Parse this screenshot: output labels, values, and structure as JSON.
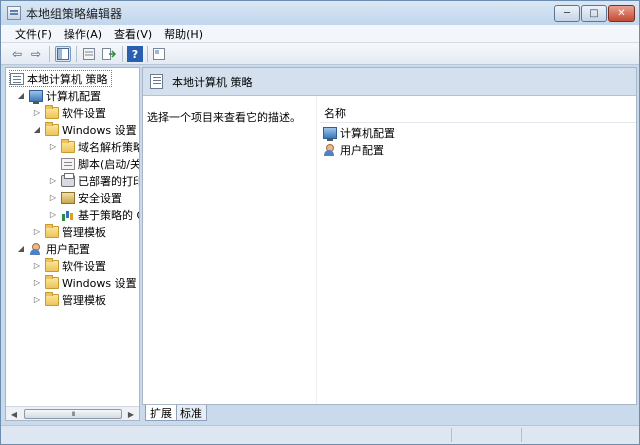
{
  "window": {
    "title": "本地组策略编辑器",
    "controls": {
      "minimize": "─",
      "maximize": "□",
      "close": "✕"
    }
  },
  "menu": [
    "文件(F)",
    "操作(A)",
    "查看(V)",
    "帮助(H)"
  ],
  "toolbar": {
    "back_icon": "⇦",
    "forward_icon": "⇨",
    "help_icon": "?"
  },
  "tree": {
    "root": "本地计算机 策略",
    "computer_config": "计算机配置",
    "cc_software": "软件设置",
    "cc_windows": "Windows 设置",
    "cc_dns": "域名解析策略",
    "cc_scripts": "脚本(启动/关",
    "cc_printers": "已部署的打印",
    "cc_security": "安全设置",
    "cc_qos": "基于策略的 C",
    "cc_admin": "管理模板",
    "user_config": "用户配置",
    "uc_software": "软件设置",
    "uc_windows": "Windows 设置",
    "uc_admin": "管理模板"
  },
  "scrollbar": {
    "left": "◀",
    "right": "▶",
    "grip": "III"
  },
  "right": {
    "header": "本地计算机 策略",
    "description": "选择一个项目来查看它的描述。",
    "column_name": "名称",
    "items": [
      "计算机配置",
      "用户配置"
    ]
  },
  "tabs": [
    "扩展",
    "标准"
  ]
}
